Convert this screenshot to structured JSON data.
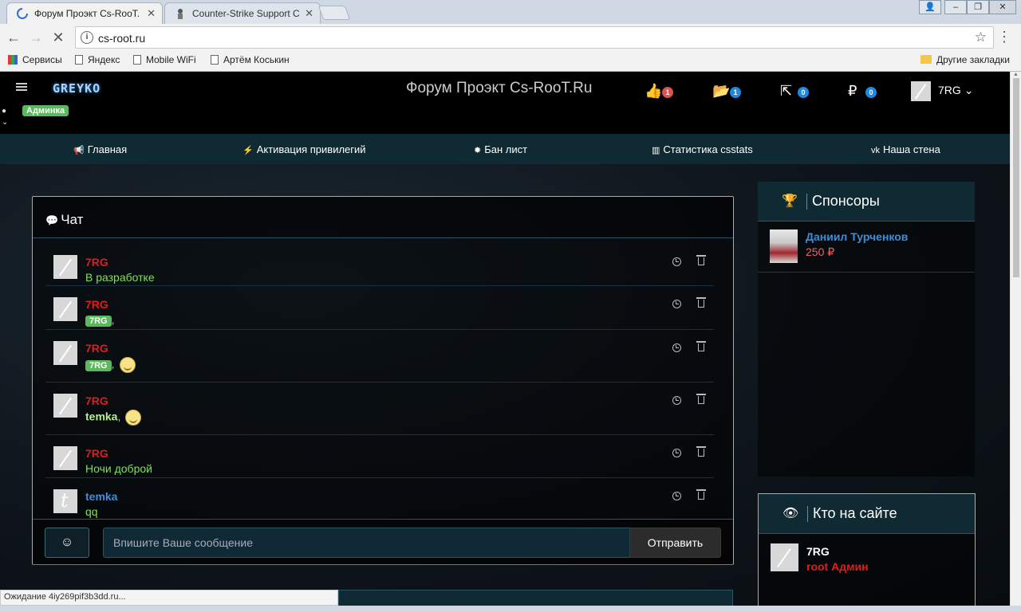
{
  "browser": {
    "tabs": [
      {
        "title": "Форум Проэкт Cs-RooT.",
        "active": true
      },
      {
        "title": "Counter-Strike Support C",
        "active": false
      }
    ],
    "url": "cs-root.ru",
    "bookmarks": [
      "Сервисы",
      "Яндекс",
      "Mobile WiFi",
      "Артём Коськин"
    ],
    "other_bookmarks": "Другие закладки",
    "status": "Ожидание 4iy269pif3b3dd.ru..."
  },
  "site": {
    "logo": "GREYKO",
    "title": "Форум Проэкт Cs-RooT.Ru",
    "counters": {
      "likes": "1",
      "files": "1",
      "shares": "0",
      "money": "0"
    },
    "user": "7RG",
    "role_badge": "Админка"
  },
  "menu": [
    {
      "label": "Главная",
      "icon": "bullhorn-icon"
    },
    {
      "label": "Активация привилегий",
      "icon": "bolt-icon"
    },
    {
      "label": "Бан лист",
      "icon": "bomb-icon"
    },
    {
      "label": "Статистика csstats",
      "icon": "bar-chart-icon"
    },
    {
      "label": "Наша стена",
      "icon": "vk-icon"
    }
  ],
  "chat": {
    "title": "Чат",
    "messages": [
      {
        "author": "7RG",
        "text": "В разработке"
      },
      {
        "author": "7RG",
        "tag": "7RG",
        "suffix": ","
      },
      {
        "author": "7RG",
        "tag": "7RG",
        "suffix": ","
      },
      {
        "author": "7RG",
        "nick": "temka",
        "suffix": ","
      },
      {
        "author": "7RG",
        "text": "Ночи доброй"
      },
      {
        "author": "temka",
        "text": "qq"
      }
    ],
    "placeholder": "Впишите Ваше сообщение",
    "send": "Отправить"
  },
  "sponsors": {
    "title": "Спонсоры",
    "name": "Даниил Турченков",
    "amount": "250 ₽"
  },
  "online": {
    "title": "Кто на сайте",
    "name": "7RG",
    "role": "root Админ"
  }
}
